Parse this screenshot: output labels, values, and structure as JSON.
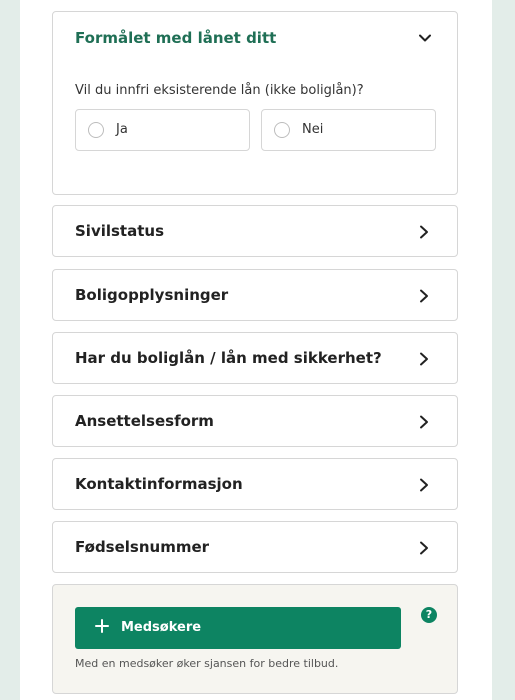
{
  "purpose_section": {
    "title": "Formålet med lånet ditt",
    "question": "Vil du innfri eksisterende lån (ikke boliglån)?",
    "options": [
      {
        "label": "Ja",
        "selected": false
      },
      {
        "label": "Nei",
        "selected": false
      }
    ]
  },
  "sections": [
    {
      "label": "Sivilstatus"
    },
    {
      "label": "Boligopplysninger"
    },
    {
      "label": "Har du boliglån / lån med sikkerhet?"
    },
    {
      "label": "Ansettelsesform"
    },
    {
      "label": "Kontaktinformasjon"
    },
    {
      "label": "Fødselsnummer"
    }
  ],
  "co_applicant": {
    "button_label": "Medsøkere",
    "help_symbol": "?",
    "hint": "Med en medsøker øker sjansen for bedre tilbud."
  },
  "colors": {
    "accent_green": "#0d8462",
    "title_green": "#1f6f55",
    "page_background": "#e3ede9"
  }
}
